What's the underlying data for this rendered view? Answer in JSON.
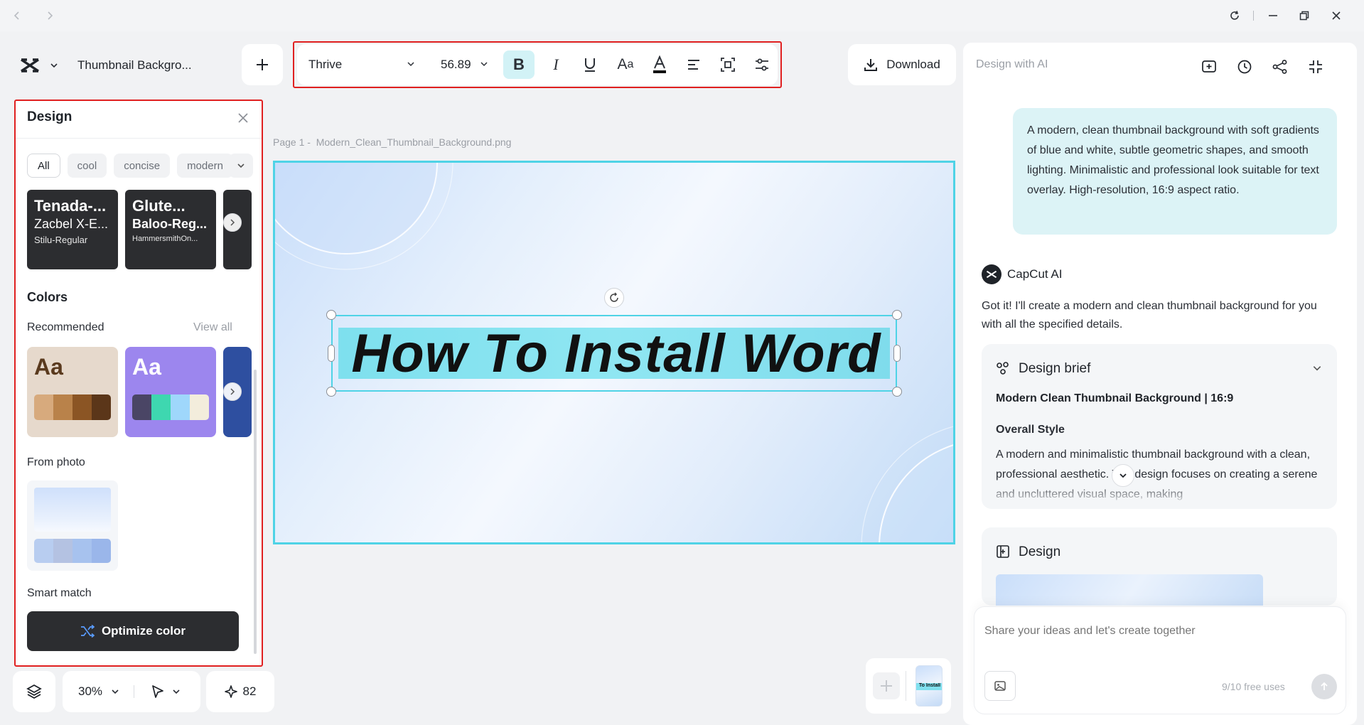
{
  "toolbar": {
    "file_name": "Thumbnail Backgro...",
    "font_name": "Thrive",
    "font_size": "56.89",
    "download_label": "Download",
    "ai_title": "Design with AI"
  },
  "design_panel": {
    "title": "Design",
    "chips": [
      "All",
      "cool",
      "concise",
      "modern"
    ],
    "font_cards": [
      {
        "line1": "Tenada-...",
        "line2": "Zacbel X-E...",
        "line3": "Stilu-Regular"
      },
      {
        "line1": "Glute...",
        "line2": "Baloo-Reg...",
        "line3": "HammersmithOn..."
      }
    ],
    "colors_title": "Colors",
    "recommended_label": "Recommended",
    "view_all": "View all",
    "palettes": [
      {
        "sample": "Aa",
        "bg": "#e6d9cc",
        "text_color": "#5a3a1e",
        "swatches": [
          "#d7aa7d",
          "#b9824a",
          "#8b5524",
          "#5b3619"
        ]
      },
      {
        "sample": "Aa",
        "bg": "#9c86ee",
        "text_color": "#ffffff",
        "swatches": [
          "#4a4565",
          "#3ed7b0",
          "#9fd7fb",
          "#f3eddc"
        ]
      }
    ],
    "from_photo_label": "From photo",
    "photo_swatches": [
      "#b8cdf0",
      "#b4c2e2",
      "#a7c2ee",
      "#9ab6ea"
    ],
    "smart_match_label": "Smart match",
    "optimize_label": "Optimize color"
  },
  "canvas": {
    "page_label": "Page 1 -",
    "file_label": "Modern_Clean_Thumbnail_Background.png",
    "headline": "How To Install Word"
  },
  "bottom_bar": {
    "zoom": "30%",
    "credits": "82",
    "thumb_text": "To Install"
  },
  "ai_panel": {
    "prompt": "A modern, clean thumbnail background with soft gradients of blue and white, subtle geometric shapes, and smooth lighting. Minimalistic and professional look suitable for text overlay. High-resolution, 16:9 aspect ratio.",
    "ai_name": "CapCut AI",
    "response": "Got it! I'll create a modern and clean thumbnail background for you with all the specified details.",
    "brief_title": "Design brief",
    "brief_subtitle": "Modern Clean Thumbnail Background | 16:9",
    "overall_style_label": "Overall Style",
    "overall_style_text": "A modern and minimalistic thumbnail background with a clean, professional aesthetic. The design focuses on creating a serene and uncluttered visual space, making",
    "design_title": "Design",
    "input_placeholder": "Share your ideas and let's create together",
    "free_uses": "9/10 free uses"
  }
}
